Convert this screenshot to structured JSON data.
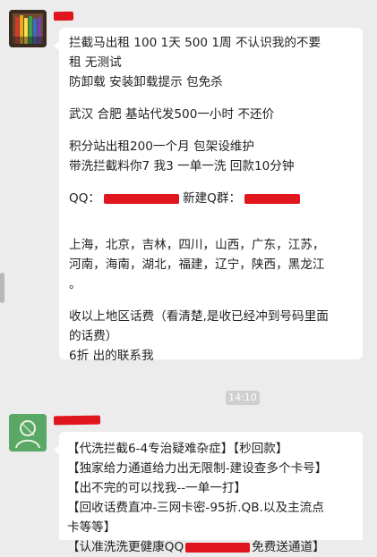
{
  "messages": [
    {
      "sender_redacted": true,
      "lines": [
        "拦截马出租 100 1天 500 1周 不认识我的不要",
        "租 无测试",
        "防卸载 安装卸载提示 包免杀",
        "",
        "武汉 合肥 基站代发500一小时 不还价",
        "",
        "积分站出租200一个月 包架设维护",
        "带洗拦截料你7 我3 一单一洗 回款10分钟"
      ],
      "contact": {
        "qq_label": "QQ：",
        "group_label": "新建Q群："
      },
      "regions_lines": [
        "上海，北京，吉林，四川，山西，广东，江苏，",
        "河南，海南，湖北，福建，辽宁，陕西，黑龙江",
        "。"
      ],
      "tail_lines": [
        "收以上地区话费（看清楚,是收已经冲到号码里面",
        "的话费）",
        "6折 出的联系我"
      ]
    },
    {
      "sender_redacted": true,
      "lines": [
        "【代洗拦截6-4专治疑难杂症】【秒回款】",
        "【独家给力通道给力出无限制-建设查多个卡号】",
        "【出不完的可以找我--一单一打】",
        "【回收话费直冲-三网卡密-95折.QB.以及主流点",
        "卡等等】"
      ],
      "last_line": {
        "prefix": "【认准洗洗更健康QQ",
        "suffix": "免费送通道】"
      }
    }
  ],
  "timestamp": "14:10",
  "colors": {
    "background": "#ececec",
    "bubble": "#ffffff",
    "redaction": "#e0151d",
    "timestamp_bg": "#cfcfcf"
  }
}
